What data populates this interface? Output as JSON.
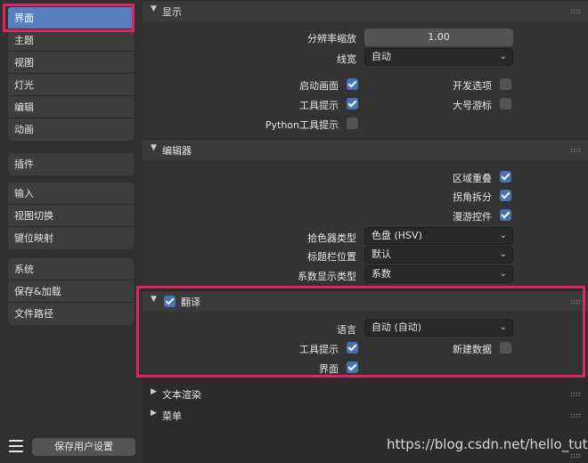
{
  "sidebar": {
    "groups": [
      [
        "界面",
        "主题",
        "视图",
        "灯光",
        "编辑",
        "动画"
      ],
      [
        "插件"
      ],
      [
        "输入",
        "视图切换",
        "键位映射"
      ],
      [
        "系统",
        "保存&加载",
        "文件路径"
      ]
    ],
    "active": "界面",
    "save_button": "保存用户设置",
    "menu_icon": "hamburger-icon"
  },
  "display": {
    "title": "显示",
    "resolution_scale_label": "分辨率缩放",
    "resolution_scale_value": "1.00",
    "line_width_label": "线宽",
    "line_width_value": "自动",
    "splash_label": "启动画面",
    "splash_checked": true,
    "tooltips_label": "工具提示",
    "tooltips_checked": true,
    "python_tooltips_label": "Python工具提示",
    "python_tooltips_checked": false,
    "developer_extras_label": "开发选项",
    "developer_extras_checked": false,
    "large_cursor_label": "大号游标",
    "large_cursor_checked": false
  },
  "editors": {
    "title": "编辑器",
    "region_overlap_label": "区域重叠",
    "region_overlap_checked": true,
    "corner_split_label": "拐角拆分",
    "corner_split_checked": true,
    "navigation_controls_label": "漫游控件",
    "navigation_controls_checked": true,
    "color_picker_label": "拾色器类型",
    "color_picker_value": "色盘 (HSV)",
    "header_position_label": "标题栏位置",
    "header_position_value": "默认",
    "factor_display_label": "系数显示类型",
    "factor_display_value": "系数"
  },
  "translation": {
    "title": "翻译",
    "enabled": true,
    "language_label": "语言",
    "language_value": "自动 (自动)",
    "tooltips_label": "工具提示",
    "tooltips_checked": true,
    "new_data_label": "新建数据",
    "new_data_checked": false,
    "interface_label": "界面",
    "interface_checked": true
  },
  "text_rendering": {
    "title": "文本渲染"
  },
  "menus": {
    "title": "菜单"
  },
  "watermark": "https://blog.csdn.net/hello_tute",
  "colors": {
    "accent": "#5680c2",
    "checkbox_on": "#4772b3",
    "highlight": "#e0245e"
  }
}
